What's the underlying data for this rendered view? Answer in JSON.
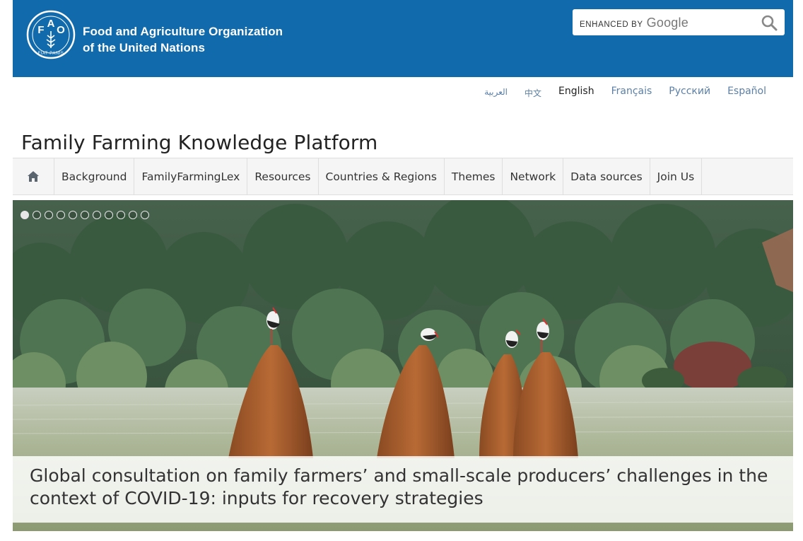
{
  "header": {
    "org_line1": "Food and Agriculture Organization",
    "org_line2": "of the United Nations",
    "emblem_letters": [
      "F",
      "A",
      "O"
    ],
    "emblem_motto": "FIAT PANIS",
    "brand_color": "#116aab"
  },
  "search": {
    "value": "",
    "placeholder": "",
    "brand_prefix": "ENHANCED BY",
    "brand_name": "Google",
    "icon": "search-icon"
  },
  "languages": [
    {
      "label": "العربية",
      "active": false
    },
    {
      "label": "中文",
      "active": false
    },
    {
      "label": "English",
      "active": true
    },
    {
      "label": "Français",
      "active": false
    },
    {
      "label": "Русский",
      "active": false
    },
    {
      "label": "Español",
      "active": false
    }
  ],
  "site_title": "Family Farming Knowledge Platform",
  "nav": {
    "home_icon": "home-icon",
    "items": [
      "Background",
      "FamilyFarmingLex",
      "Resources",
      "Countries & Regions",
      "Themes",
      "Network",
      "Data sources",
      "Join Us"
    ]
  },
  "slider": {
    "slide_count": 11,
    "active_index": 0,
    "caption": "Global consultation on family farmers’ and small-scale producers’ challenges in the context of COVID-19: inputs for recovery strategies"
  }
}
